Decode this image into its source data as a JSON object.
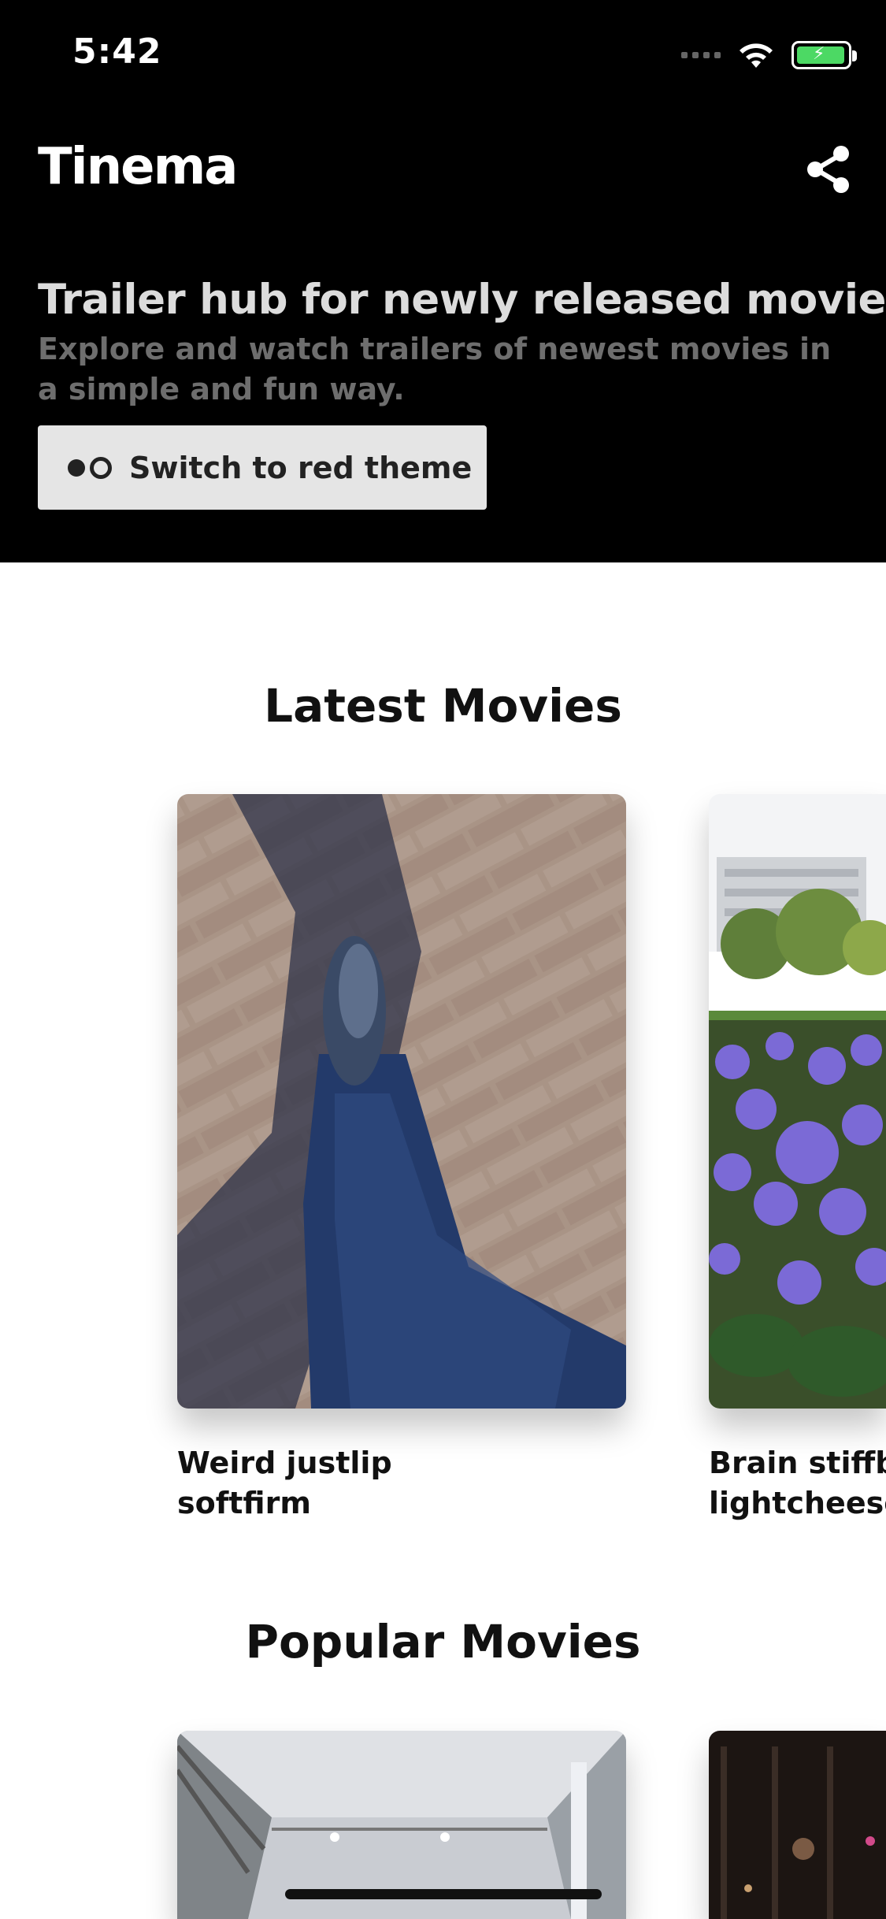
{
  "status_bar": {
    "time": "5:42"
  },
  "app": {
    "title": "Tinema"
  },
  "hero": {
    "headline": "Trailer hub for newly released movies",
    "subline": "Explore and watch trailers of newest movies in a simple and fun way.",
    "theme_button_label": "Switch to red theme"
  },
  "sections": {
    "latest": {
      "title": "Latest Movies",
      "movies": [
        {
          "title": "Weird justlip\nsoftfirm"
        },
        {
          "title": "Brain stiffbla\nlightcheese"
        }
      ]
    },
    "popular": {
      "title": "Popular Movies"
    }
  },
  "icons": [
    "share-icon",
    "wifi-icon",
    "battery-charging-icon",
    "signal-icon",
    "theme-dots-icon"
  ]
}
